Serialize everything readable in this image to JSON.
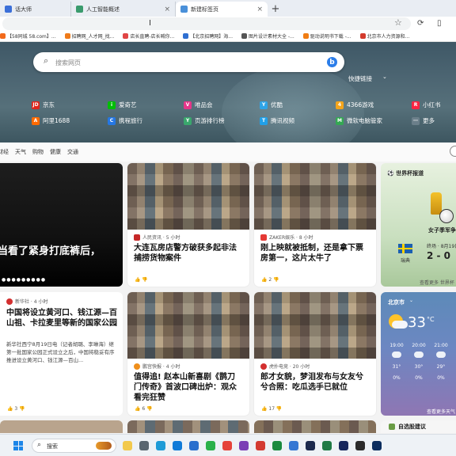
{
  "tabs": [
    {
      "title": "话大师",
      "color": "#3b6fd8"
    },
    {
      "title": "人工智能概述",
      "color": "#3a9b6d"
    },
    {
      "title": "新建标签页",
      "color": "#4a90d9",
      "active": true
    }
  ],
  "tab_close": "×",
  "new_tab": "+",
  "bookmarks": [
    {
      "label": "【58同城 58.com】...",
      "color": "#f26a1b"
    },
    {
      "label": "招聘网_人才网_找...",
      "color": "#ef7b1a"
    },
    {
      "label": "店长直聘-店长喊你...",
      "color": "#e04545"
    },
    {
      "label": "【北京招聘网】海...",
      "color": "#2f6fd1"
    },
    {
      "label": "图片设计素材大全 -...",
      "color": "#555555"
    },
    {
      "label": "驱动说明书下载 -...",
      "color": "#f07d13"
    },
    {
      "label": "北京市人力资源和...",
      "color": "#d33a2c"
    }
  ],
  "search": {
    "placeholder": "搜索网页",
    "bing": "b"
  },
  "quick_links_label": "快捷链接",
  "quick_links": [
    {
      "label": "京东",
      "color": "#e1251b",
      "glyph": "JD"
    },
    {
      "label": "爱奇艺",
      "color": "#00be06",
      "glyph": "i"
    },
    {
      "label": "唯品会",
      "color": "#e6368a",
      "glyph": "V"
    },
    {
      "label": "优酷",
      "color": "#2fa4e7",
      "glyph": "Y"
    },
    {
      "label": "4366游戏",
      "color": "#f4a51c",
      "glyph": "4"
    },
    {
      "label": "小红书",
      "color": "#ff2442",
      "glyph": "R"
    },
    {
      "label": "阿里1688",
      "color": "#ff6a00",
      "glyph": "A"
    },
    {
      "label": "携程旅行",
      "color": "#2577e3",
      "glyph": "C"
    },
    {
      "label": "页游排行榜",
      "color": "#3aa76d",
      "glyph": "Y"
    },
    {
      "label": "腾讯视频",
      "color": "#21a0e8",
      "glyph": "T"
    },
    {
      "label": "微软电脑管家",
      "color": "#34a853",
      "glyph": "M"
    },
    {
      "label": "更多",
      "color": "#6b7f8a",
      "glyph": "⋯"
    }
  ],
  "categories": [
    "财经",
    "天气",
    "购物",
    "健康",
    "交通"
  ],
  "featured": {
    "title": "当看了紧身打底裤后，",
    "dots": "●●●●●●●●●"
  },
  "cards": [
    {
      "source": "人民资讯 · 5 小时",
      "src_color": "#c62828",
      "headline": "大连瓦房店警方破获多起非法捕捞货物案件",
      "likes": "",
      "react": "👍  👎"
    },
    {
      "source": "ZAKER娱乐 · 8 小时",
      "src_color": "#e53935",
      "headline": "刚上映就被抵制，还是拿下票房第一，这片太牛了",
      "likes": "2",
      "react": "👍 2  👎"
    },
    {
      "source": "鹏宫快报 · 4 小时",
      "src_color": "#ef8f1c",
      "headline": "值得追! 赵本山新喜剧《鹊刀门传奇》首波口碑出炉：观众看完狂赞",
      "likes": "6",
      "react": "👍 6  👎"
    },
    {
      "source": "虎扑电竞 · 20 小时",
      "src_color": "#d32f2f",
      "headline": "郎才女貌，梦泪发布与女友兮兮合照：吃瓜选手已就位",
      "likes": "17",
      "react": "👍 17  👎"
    }
  ],
  "long_article": {
    "source": "新华社 · 4 小时",
    "headline": "中国将设立黄河口、钱江源—百山祖、卡拉麦里等新的国家公园",
    "abstract": "新华社西宁8月19日电（记者胡璐、李琳海）继第一批国家公园正式设立之后，中国将稳妥有序推进设立黄河口、钱江源—百山...",
    "react": "👍 3  👎"
  },
  "sport": {
    "header": "世界杯报道",
    "card_title": "女子季军争夺",
    "team": "瑞典",
    "date": "终场 · 8月19日",
    "score": "2 - 0",
    "more": "查看更多 世界杯"
  },
  "weather": {
    "city": "北京市",
    "chevron": "⌄",
    "temp": "33",
    "unit": "°C",
    "hours": [
      {
        "time": "19:00",
        "temp": "31°",
        "precip": "0%"
      },
      {
        "time": "20:00",
        "temp": "30°",
        "precip": "0%"
      },
      {
        "time": "21:00",
        "temp": "29°",
        "precip": "0%"
      }
    ],
    "more": "查看更多天气"
  },
  "stock": {
    "label": "自选股建议"
  },
  "taskbar": {
    "search_label": "搜索"
  },
  "taskbar_apps": [
    {
      "name": "file-explorer-icon",
      "color": "#f2c94c"
    },
    {
      "name": "taskview-icon",
      "color": "#5a6670"
    },
    {
      "name": "edge-icon",
      "color": "#1e9bd7"
    },
    {
      "name": "store-icon",
      "color": "#0f7ad8"
    },
    {
      "name": "mail-icon",
      "color": "#2a6fcd"
    },
    {
      "name": "wechat-icon",
      "color": "#2ab14a"
    },
    {
      "name": "chrome-icon",
      "color": "#e5433a"
    },
    {
      "name": "media-icon",
      "color": "#7b3fb5"
    },
    {
      "name": "wps-icon",
      "color": "#d33b32"
    },
    {
      "name": "app-icon",
      "color": "#1a8a3f"
    },
    {
      "name": "app2-icon",
      "color": "#3577d3"
    },
    {
      "name": "ps-icon",
      "color": "#1c2a4d"
    },
    {
      "name": "excel-icon",
      "color": "#1f7a45"
    },
    {
      "name": "au-icon",
      "color": "#17275c"
    },
    {
      "name": "app3-icon",
      "color": "#2b2b2b"
    },
    {
      "name": "ps2-icon",
      "color": "#0b2d5e"
    }
  ]
}
